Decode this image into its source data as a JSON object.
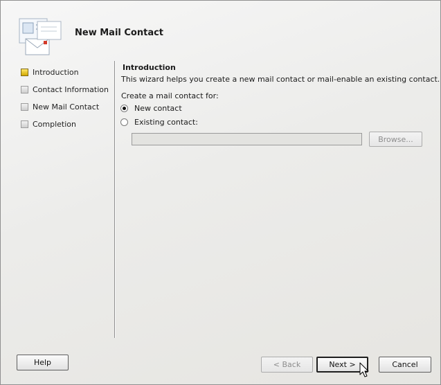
{
  "window": {
    "title": "New Mail Contact"
  },
  "steps": [
    {
      "label": "Introduction",
      "state": "active"
    },
    {
      "label": "Contact Information",
      "state": "pending"
    },
    {
      "label": "New Mail Contact",
      "state": "pending"
    },
    {
      "label": "Completion",
      "state": "pending"
    }
  ],
  "content": {
    "title": "Introduction",
    "description": "This wizard helps you create a new mail contact or mail-enable an existing contact.",
    "create_label": "Create a mail contact for:",
    "options": [
      {
        "label": "New contact",
        "selected": true
      },
      {
        "label": "Existing contact:",
        "selected": false
      }
    ],
    "existing_contact_value": "",
    "browse_label": "Browse..."
  },
  "footer": {
    "help_label": "Help",
    "back_label": "< Back",
    "next_label": "Next >",
    "cancel_label": "Cancel"
  },
  "icons": {
    "wizard": "mail-contact-icon",
    "cursor": "mouse-pointer-icon"
  },
  "colors": {
    "active_step": "#e8c21a",
    "pending_step": "#d8d8d8",
    "divider": "#8f8f8f"
  }
}
